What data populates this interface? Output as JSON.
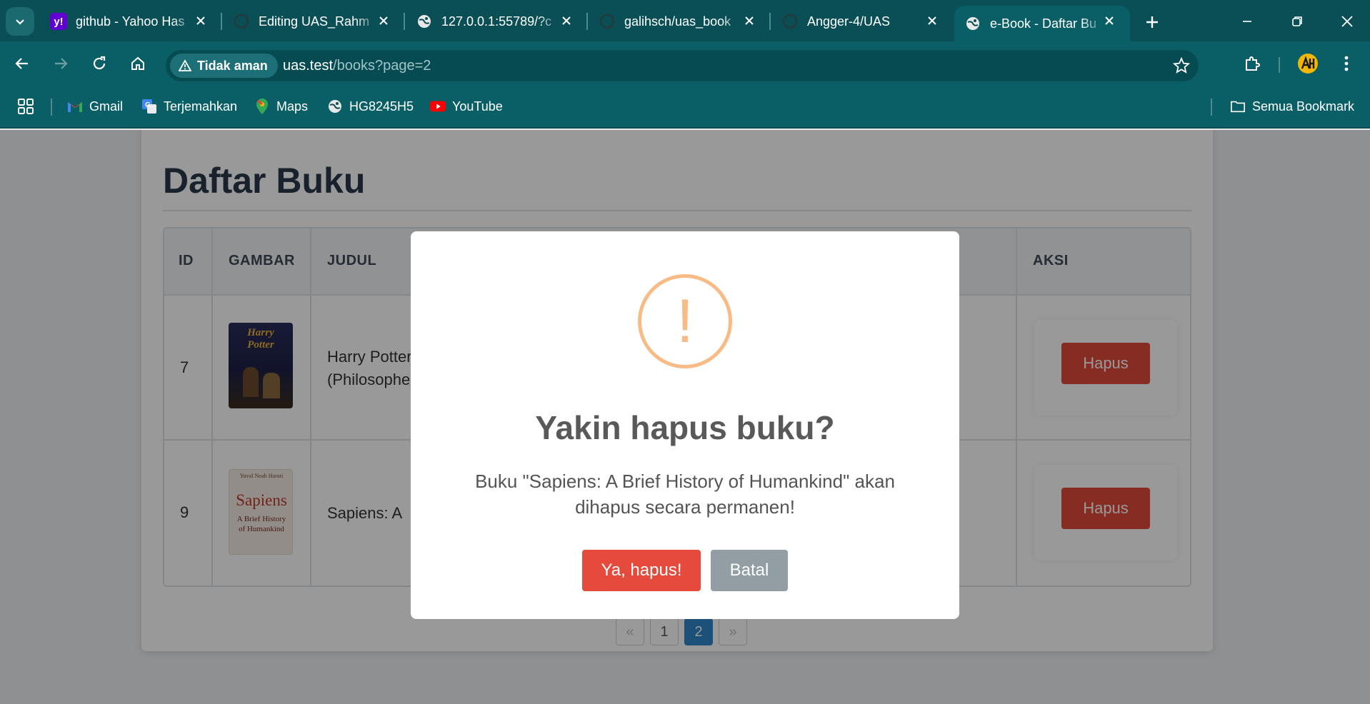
{
  "browser": {
    "tabs": [
      {
        "title": "github - Yahoo Has",
        "icon": "yahoo-icon"
      },
      {
        "title": "Editing UAS_Rahm",
        "icon": "github-icon"
      },
      {
        "title": "127.0.0.1:55789/?c",
        "icon": "globe-icon"
      },
      {
        "title": "galihsch/uas_book",
        "icon": "github-icon"
      },
      {
        "title": "Angger-4/UAS",
        "icon": "github-icon"
      },
      {
        "title": "e-Book - Daftar Bu",
        "icon": "globe-icon",
        "active": true
      }
    ],
    "security_label": "Tidak aman",
    "url_host": "uas.test",
    "url_path": "/books?page=2",
    "bookmarks": [
      {
        "label": "Gmail",
        "icon": "gmail-icon"
      },
      {
        "label": "Terjemahkan",
        "icon": "translate-icon"
      },
      {
        "label": "Maps",
        "icon": "maps-icon"
      },
      {
        "label": "HG8245H5",
        "icon": "globe-icon"
      },
      {
        "label": "YouTube",
        "icon": "youtube-icon"
      }
    ],
    "all_bookmarks_label": "Semua Bookmark"
  },
  "page": {
    "title": "Daftar Buku",
    "table": {
      "headers": [
        "ID",
        "GAMBAR",
        "JUDUL",
        "AKSI"
      ],
      "rows": [
        {
          "id": "7",
          "title_line1": "Harry Potter",
          "title_line2": "(Philosophe",
          "cover_text": "Harry Potter",
          "action": "Hapus"
        },
        {
          "id": "9",
          "title_line1": "Sapiens: A",
          "title_line2": "",
          "cover_text": "Sapiens",
          "cover_author": "Yuval Noah Harari",
          "cover_sub": "A Brief History of Humankind",
          "action": "Hapus"
        }
      ]
    },
    "pagination": [
      "«",
      "1",
      "2",
      "»"
    ],
    "current_page": "2"
  },
  "modal": {
    "icon": "!",
    "title": "Yakin hapus buku?",
    "text": "Buku \"Sapiens: A Brief History of Humankind\" akan dihapus secara permanen!",
    "confirm_label": "Ya, hapus!",
    "cancel_label": "Batal"
  },
  "colors": {
    "chrome": "#0a5f67",
    "danger": "#e64a3c",
    "warning": "#f8bb86",
    "cancel": "#929ea3",
    "pager_active": "#2f86c9"
  }
}
